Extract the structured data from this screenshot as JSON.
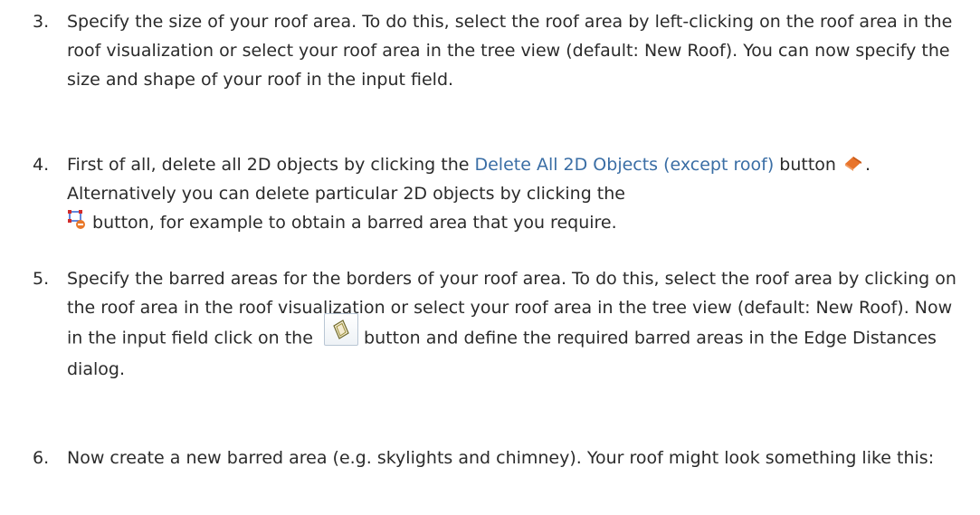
{
  "steps": [
    {
      "number": "3.",
      "text": "Specify the size of your roof area. To do this, select the roof area by left-clicking on the roof area in the roof visualization or select your roof area in the tree view (default: New Roof). You can now specify the size and shape of your roof in the input field."
    },
    {
      "number": "4.",
      "text_before_link": "First of all, delete all 2D objects by clicking the ",
      "link": "Delete All 2D Objects (except roof)",
      "text_after_link_1": " button",
      "text_after_roof_icon": ". Alternatively you can delete particular 2D objects by clicking the",
      "text_after_delete_icon": "button, for example to obtain a barred area that you require."
    },
    {
      "number": "5.",
      "text_before_button": "Specify the barred areas for the borders of your roof area. To do this, select the roof area by clicking on the roof area in the roof visualization or select your roof area in the tree view (default: New Roof). Now in the input field click on the",
      "text_after_button": "button and define the required barred areas in the Edge Distances dialog."
    },
    {
      "number": "6.",
      "text": "Now create a new barred area (e.g. skylights and chimney). Your roof might look something like this:"
    }
  ],
  "icons": {
    "roof": "roof-icon",
    "delete_object": "delete-2d-object-icon",
    "edge_distances": "edge-distances-icon"
  }
}
